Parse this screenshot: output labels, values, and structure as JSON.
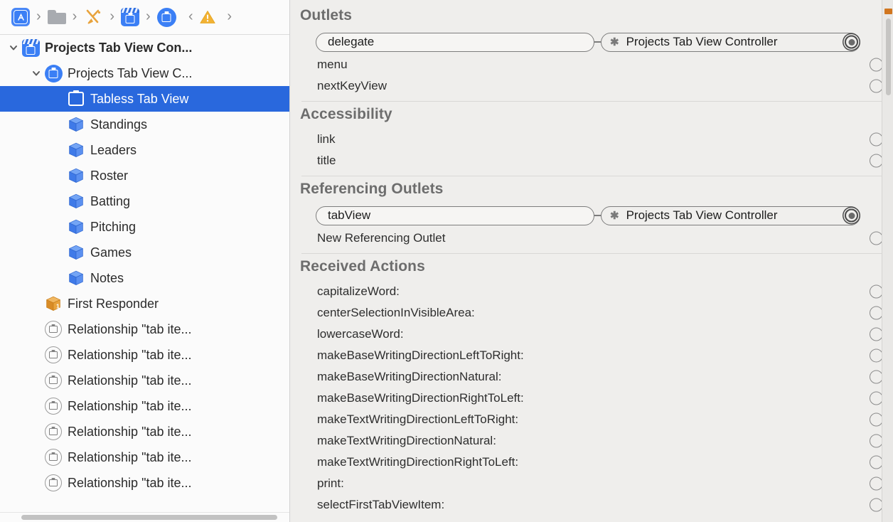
{
  "jump_bar": {
    "items": [
      {
        "icon": "appstore-icon",
        "name": "project-icon"
      },
      {
        "icon": "folder-icon",
        "name": "group-folder-icon"
      },
      {
        "icon": "xib-icon",
        "name": "interface-file-icon"
      },
      {
        "icon": "storyboard-icon",
        "name": "storyboard-scene-icon"
      },
      {
        "icon": "view-controller-icon",
        "name": "tab-view-controller-icon"
      }
    ],
    "separator": "›",
    "back_chevron": "‹",
    "forward_chevron": "›",
    "warning_icon": "warning-triangle-icon"
  },
  "outline": {
    "rows": [
      {
        "label": "Projects Tab View Con...",
        "icon": "storyboard-scene-icon",
        "indent": 0,
        "disclosure": "open",
        "bold": true,
        "selected": false
      },
      {
        "label": "Projects Tab View C...",
        "icon": "view-controller-circle-icon",
        "indent": 1,
        "disclosure": "open",
        "bold": false,
        "selected": false
      },
      {
        "label": "Tabless Tab View",
        "icon": "tab-view-icon",
        "indent": 2,
        "disclosure": "none",
        "bold": false,
        "selected": true
      },
      {
        "label": "Standings",
        "icon": "cube-icon",
        "indent": 2,
        "disclosure": "none",
        "bold": false,
        "selected": false
      },
      {
        "label": "Leaders",
        "icon": "cube-icon",
        "indent": 2,
        "disclosure": "none",
        "bold": false,
        "selected": false
      },
      {
        "label": "Roster",
        "icon": "cube-icon",
        "indent": 2,
        "disclosure": "none",
        "bold": false,
        "selected": false
      },
      {
        "label": "Batting",
        "icon": "cube-icon",
        "indent": 2,
        "disclosure": "none",
        "bold": false,
        "selected": false
      },
      {
        "label": "Pitching",
        "icon": "cube-icon",
        "indent": 2,
        "disclosure": "none",
        "bold": false,
        "selected": false
      },
      {
        "label": "Games",
        "icon": "cube-icon",
        "indent": 2,
        "disclosure": "none",
        "bold": false,
        "selected": false
      },
      {
        "label": "Notes",
        "icon": "cube-icon",
        "indent": 2,
        "disclosure": "none",
        "bold": false,
        "selected": false
      },
      {
        "label": "First Responder",
        "icon": "first-responder-icon",
        "indent": 1,
        "disclosure": "none",
        "bold": false,
        "selected": false
      },
      {
        "label": "Relationship \"tab ite...",
        "icon": "relationship-icon",
        "indent": 1,
        "disclosure": "none",
        "bold": false,
        "selected": false
      },
      {
        "label": "Relationship \"tab ite...",
        "icon": "relationship-icon",
        "indent": 1,
        "disclosure": "none",
        "bold": false,
        "selected": false
      },
      {
        "label": "Relationship \"tab ite...",
        "icon": "relationship-icon",
        "indent": 1,
        "disclosure": "none",
        "bold": false,
        "selected": false
      },
      {
        "label": "Relationship \"tab ite...",
        "icon": "relationship-icon",
        "indent": 1,
        "disclosure": "none",
        "bold": false,
        "selected": false
      },
      {
        "label": "Relationship \"tab ite...",
        "icon": "relationship-icon",
        "indent": 1,
        "disclosure": "none",
        "bold": false,
        "selected": false
      },
      {
        "label": "Relationship \"tab ite...",
        "icon": "relationship-icon",
        "indent": 1,
        "disclosure": "none",
        "bold": false,
        "selected": false
      },
      {
        "label": "Relationship \"tab ite...",
        "icon": "relationship-icon",
        "indent": 1,
        "disclosure": "none",
        "bold": false,
        "selected": false
      }
    ]
  },
  "inspector": {
    "sections": [
      {
        "title": "Outlets",
        "rows": [
          {
            "label": "delegate",
            "connected": true,
            "target": "Projects Tab View Controller",
            "disconnect": "✱"
          },
          {
            "label": "menu",
            "connected": false
          },
          {
            "label": "nextKeyView",
            "connected": false
          }
        ]
      },
      {
        "title": "Accessibility",
        "rows": [
          {
            "label": "link",
            "connected": false
          },
          {
            "label": "title",
            "connected": false
          }
        ]
      },
      {
        "title": "Referencing Outlets",
        "rows": [
          {
            "label": "tabView",
            "connected": true,
            "target": "Projects Tab View Controller",
            "disconnect": "✱"
          },
          {
            "label": "New Referencing Outlet",
            "connected": false
          }
        ]
      },
      {
        "title": "Received Actions",
        "rows": [
          {
            "label": "capitalizeWord:",
            "connected": false
          },
          {
            "label": "centerSelectionInVisibleArea:",
            "connected": false
          },
          {
            "label": "lowercaseWord:",
            "connected": false
          },
          {
            "label": "makeBaseWritingDirectionLeftToRight:",
            "connected": false
          },
          {
            "label": "makeBaseWritingDirectionNatural:",
            "connected": false
          },
          {
            "label": "makeBaseWritingDirectionRightToLeft:",
            "connected": false
          },
          {
            "label": "makeTextWritingDirectionLeftToRight:",
            "connected": false
          },
          {
            "label": "makeTextWritingDirectionNatural:",
            "connected": false
          },
          {
            "label": "makeTextWritingDirectionRightToLeft:",
            "connected": false
          },
          {
            "label": "print:",
            "connected": false
          },
          {
            "label": "selectFirstTabViewItem:",
            "connected": false
          }
        ]
      }
    ]
  },
  "colors": {
    "selection_blue": "#2968dd",
    "icon_blue": "#3b7ff5",
    "cube_blue": "#4a86f0",
    "first_responder_orange": "#e8a33d",
    "warning_yellow": "#f2b233",
    "inspector_bg": "#efeeec",
    "outline_bg": "#fbfbfb",
    "scroll_marker_orange": "#d1761f"
  }
}
